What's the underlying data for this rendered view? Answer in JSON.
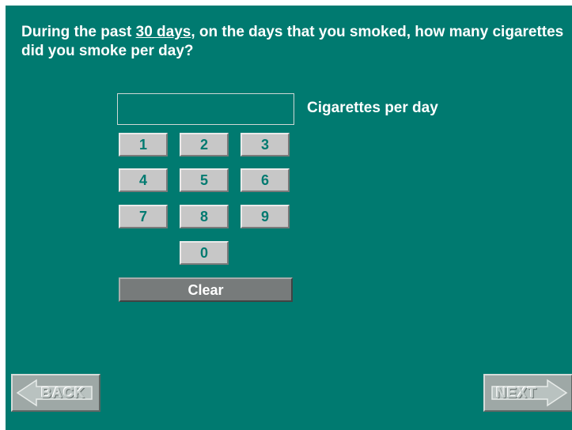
{
  "question": {
    "part1": "During the past ",
    "emphasis": "30 days",
    "part2": ", on the days that you smoked, how many cigarettes did you smoke per day?"
  },
  "answer": {
    "value": "",
    "unit_label": "Cigarettes per day"
  },
  "keypad": {
    "keys": [
      "1",
      "2",
      "3",
      "4",
      "5",
      "6",
      "7",
      "8",
      "9",
      "0"
    ],
    "clear_label": "Clear"
  },
  "navigation": {
    "back_label": "BACK",
    "back_icon": "arrow-left-icon",
    "next_label": "NEXT",
    "next_icon": "arrow-right-icon"
  },
  "colors": {
    "background": "#007a70",
    "text": "#ffffff",
    "key_face": "#c7c7c7",
    "key_text": "#007a70",
    "clear_face": "#777b7b"
  }
}
